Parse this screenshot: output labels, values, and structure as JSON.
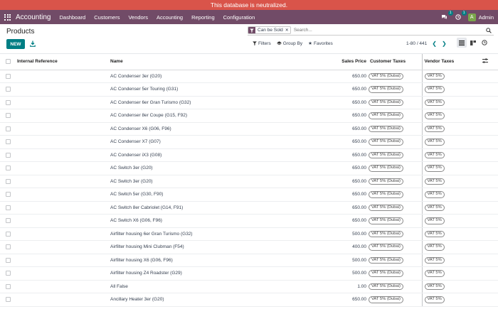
{
  "banner": "This database is neutralized.",
  "navbar": {
    "brand": "Accounting",
    "menu": [
      "Dashboard",
      "Customers",
      "Vendors",
      "Accounting",
      "Reporting",
      "Configuration"
    ],
    "messages_count": "1",
    "activities_count": "1",
    "avatar_letter": "A",
    "user": "Admin"
  },
  "page": {
    "title": "Products",
    "new_label": "NEW",
    "facet": "Can be Sold",
    "search_placeholder": "Search...",
    "filters": "Filters",
    "group_by": "Group By",
    "favorites": "Favorites",
    "pager": "1-80 / 441"
  },
  "table": {
    "headers": {
      "ref": "Internal Reference",
      "name": "Name",
      "price": "Sales Price",
      "ctax": "Customer Taxes",
      "vtax": "Vendor Taxes"
    },
    "rows": [
      {
        "name": "AC Condenser 3er (G20)",
        "price": "650.00",
        "ctax": "VAT 5% (Dubai)",
        "vtax": "VAT 5%"
      },
      {
        "name": "AC Condenser 5er Touring (G31)",
        "price": "650.00",
        "ctax": "VAT 5% (Dubai)",
        "vtax": "VAT 5%"
      },
      {
        "name": "AC Condenser 6er Gran Turismo (G32)",
        "price": "650.00",
        "ctax": "VAT 5% (Dubai)",
        "vtax": "VAT 5%"
      },
      {
        "name": "AC Condenser 8er Coupe (G15, F92)",
        "price": "650.00",
        "ctax": "VAT 5% (Dubai)",
        "vtax": "VAT 5%"
      },
      {
        "name": "AC Condenser X6 (G06, F96)",
        "price": "650.00",
        "ctax": "VAT 5% (Dubai)",
        "vtax": "VAT 5%"
      },
      {
        "name": "AC Condenser X7 (G07)",
        "price": "650.00",
        "ctax": "VAT 5% (Dubai)",
        "vtax": "VAT 5%"
      },
      {
        "name": "AC Condenser iX3 (G08)",
        "price": "650.00",
        "ctax": "VAT 5% (Dubai)",
        "vtax": "VAT 5%"
      },
      {
        "name": "AC Switch 3er (G20)",
        "price": "650.00",
        "ctax": "VAT 5% (Dubai)",
        "vtax": "VAT 5%"
      },
      {
        "name": "AC Switch 3er (G20)",
        "price": "650.00",
        "ctax": "VAT 5% (Dubai)",
        "vtax": "VAT 5%"
      },
      {
        "name": "AC Switch 5er (G30, F90)",
        "price": "650.00",
        "ctax": "VAT 5% (Dubai)",
        "vtax": "VAT 5%"
      },
      {
        "name": "AC Switch 8er Cabriolet (G14, F91)",
        "price": "650.00",
        "ctax": "VAT 5% (Dubai)",
        "vtax": "VAT 5%"
      },
      {
        "name": "AC Switch X6 (G06, F96)",
        "price": "650.00",
        "ctax": "VAT 5% (Dubai)",
        "vtax": "VAT 5%"
      },
      {
        "name": "Airfilter housing 6er Gran Turismo (G32)",
        "price": "500.00",
        "ctax": "VAT 5% (Dubai)",
        "vtax": "VAT 5%"
      },
      {
        "name": "Airfilter housing Mini Clubman (F54)",
        "price": "400.00",
        "ctax": "VAT 5% (Dubai)",
        "vtax": "VAT 5%"
      },
      {
        "name": "Airfilter housing X6 (G06, F96)",
        "price": "500.00",
        "ctax": "VAT 5% (Dubai)",
        "vtax": "VAT 5%"
      },
      {
        "name": "Airfilter housing Z4 Roadster (G29)",
        "price": "500.00",
        "ctax": "VAT 5% (Dubai)",
        "vtax": "VAT 5%"
      },
      {
        "name": "All False",
        "price": "1.00",
        "ctax": "VAT 5% (Dubai)",
        "vtax": "VAT 5%"
      },
      {
        "name": "Ancillary Heater 3er (G20)",
        "price": "650.00",
        "ctax": "VAT 5% (Dubai)",
        "vtax": "VAT 5%"
      }
    ]
  }
}
